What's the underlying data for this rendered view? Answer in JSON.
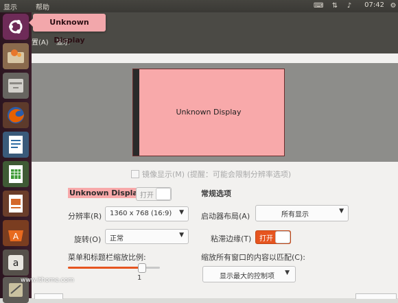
{
  "top_panel": {
    "menu": [
      "显示",
      "帮助"
    ],
    "time": "07:42",
    "tray_icons": [
      "keyboard-icon",
      "network-icon",
      "volume-icon",
      "gear-icon"
    ]
  },
  "launcher": {
    "tooltip": "Unknown Display",
    "items": [
      "ubuntu-dash-icon",
      "software-updater-icon",
      "files-icon",
      "firefox-icon",
      "writer-icon",
      "calc-icon",
      "impress-icon",
      "software-center-icon",
      "amazon-icon",
      "settings-icon"
    ]
  },
  "window": {
    "menubar": [
      "置(A)",
      "显示"
    ]
  },
  "preview": {
    "monitor_label": "Unknown Display"
  },
  "mirror": {
    "label": "镜像显示(M) (提醒：可能会限制分辨率选项)",
    "checked": false
  },
  "display": {
    "name": "Unknown Display",
    "toggle_label": "打开",
    "toggle_on": false,
    "resolution_label": "分辨率(R)",
    "resolution_value": "1360 x 768 (16:9)",
    "rotation_label": "旋转(O)",
    "rotation_value": "正常",
    "scale_label": "菜单和标题栏缩放比例:",
    "scale_value": "1",
    "scale_level": 0.8
  },
  "general": {
    "title": "常规选项",
    "launcher_label": "启动器布局(A)",
    "launcher_value": "所有显示",
    "sticky_label": "粘滞边缘(T)",
    "sticky_toggle": "打开",
    "sticky_on": true,
    "scale_all_label": "缩放所有窗口的内容以匹配(C):",
    "scale_all_value": "显示最大的控制项"
  },
  "watermark": "www.ithome.com",
  "colors": {
    "accent": "#e6541f",
    "monitor": "#f8a9aa",
    "launcher": "#2c1520"
  }
}
